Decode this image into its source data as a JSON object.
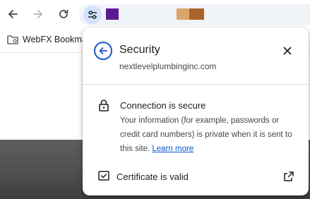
{
  "toolbar": {
    "back_icon": "arrow-left-icon",
    "forward_icon": "arrow-right-icon",
    "reload_icon": "reload-icon",
    "site_info_icon": "tune-icon"
  },
  "bookmarks": {
    "items": [
      {
        "label": "WebFX Bookma",
        "icon": "folder-icon"
      }
    ]
  },
  "popup": {
    "title": "Security",
    "domain": "nextlevelplumbinginc.com",
    "connection": {
      "title": "Connection is secure",
      "description": "Your information (for example, passwords or credit card numbers) is private when it is sent to this site.",
      "learn_more": "Learn more"
    },
    "certificate": {
      "label": "Certificate is valid"
    }
  },
  "colors": {
    "accent": "#1a56c7",
    "link": "#0b57d0",
    "site_info_bg": "#d3e3fd",
    "redaction_purple": "#5b1a91",
    "redaction_tan": "#dba56a",
    "redaction_brown": "#a8642a"
  }
}
